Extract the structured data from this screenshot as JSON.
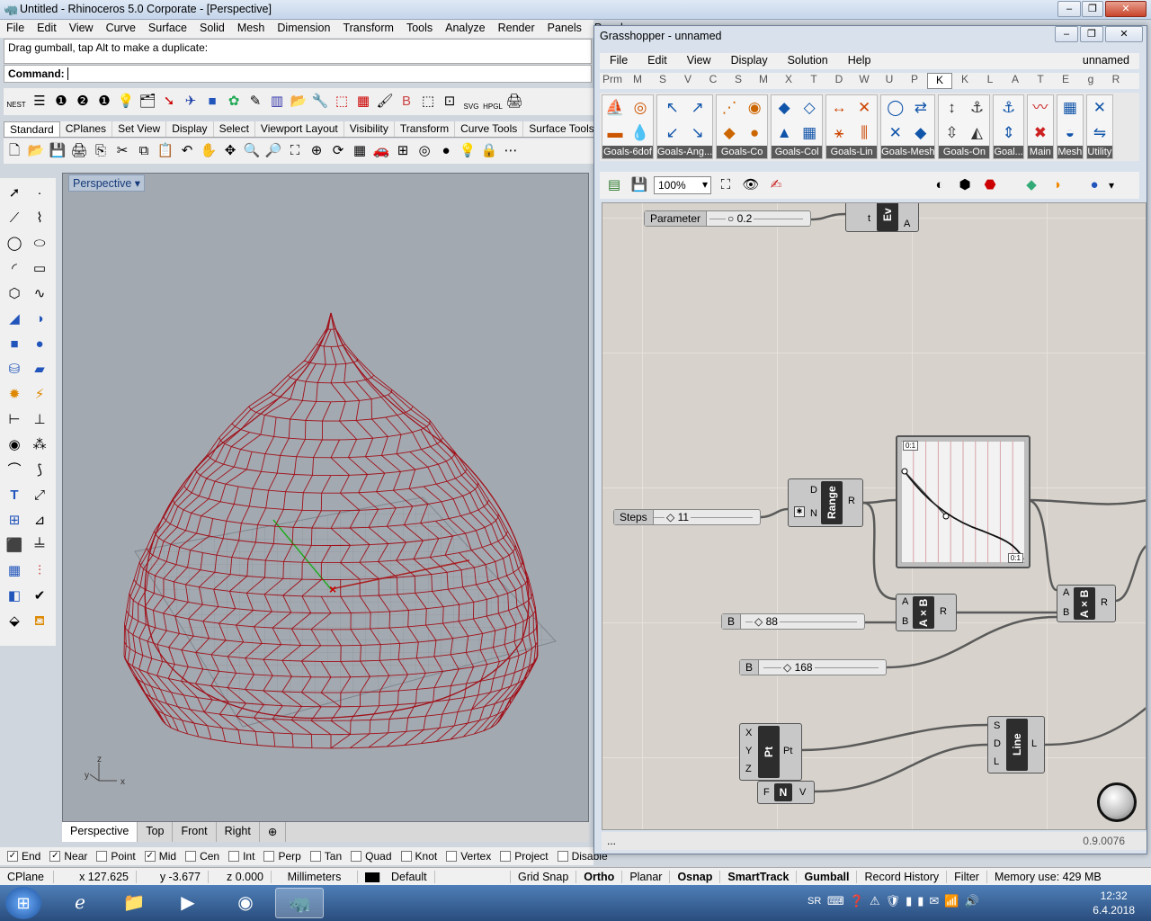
{
  "window": {
    "title": "Untitled - Rhinoceros  5.0 Corporate - [Perspective]"
  },
  "menu": [
    "File",
    "Edit",
    "View",
    "Curve",
    "Surface",
    "Solid",
    "Mesh",
    "Dimension",
    "Transform",
    "Tools",
    "Analyze",
    "Render",
    "Panels",
    "Panel"
  ],
  "command": {
    "history": "Drag gumball, tap Alt to make a duplicate:",
    "prompt": "Command:"
  },
  "tabs": [
    "Standard",
    "CPlanes",
    "Set View",
    "Display",
    "Select",
    "Viewport Layout",
    "Visibility",
    "Transform",
    "Curve Tools",
    "Surface Tools"
  ],
  "toolbar1_labels": {
    "nest": "NEST",
    "svg": "SVG",
    "hpgl": "HPGL"
  },
  "viewport": {
    "title": "Perspective",
    "axes": {
      "x": "x",
      "y": "y",
      "z": "z"
    }
  },
  "viewport_tabs": [
    "Perspective",
    "Top",
    "Front",
    "Right"
  ],
  "osnap": [
    {
      "label": "End",
      "checked": true
    },
    {
      "label": "Near",
      "checked": true
    },
    {
      "label": "Point",
      "checked": false
    },
    {
      "label": "Mid",
      "checked": true
    },
    {
      "label": "Cen",
      "checked": false
    },
    {
      "label": "Int",
      "checked": false
    },
    {
      "label": "Perp",
      "checked": false
    },
    {
      "label": "Tan",
      "checked": false
    },
    {
      "label": "Quad",
      "checked": false
    },
    {
      "label": "Knot",
      "checked": false
    },
    {
      "label": "Vertex",
      "checked": false
    },
    {
      "label": "Project",
      "checked": false
    },
    {
      "label": "Disable",
      "checked": false
    }
  ],
  "status": {
    "cplane": "CPlane",
    "x": "x 127.625",
    "y": "y -3.677",
    "z": "z 0.000",
    "units": "Millimeters",
    "layer": "Default",
    "modes": [
      "Grid Snap",
      "Ortho",
      "Planar",
      "Osnap",
      "SmartTrack",
      "Gumball",
      "Record History",
      "Filter"
    ],
    "memory": "Memory use: 429 MB"
  },
  "clock": {
    "time": "12:32",
    "date": "6.4.2018",
    "lang": "SR"
  },
  "gh": {
    "title": "Grasshopper - unnamed",
    "menu": [
      "File",
      "Edit",
      "View",
      "Display",
      "Solution",
      "Help"
    ],
    "filename": "unnamed",
    "tabs": [
      "Prm",
      "M",
      "S",
      "V",
      "C",
      "S",
      "M",
      "X",
      "T",
      "D",
      "W",
      "U",
      "P",
      "K",
      "K",
      "L",
      "A",
      "T",
      "E",
      "g",
      "R"
    ],
    "active_tab": 13,
    "groups": [
      "Goals-6dof",
      "Goals-Ang...",
      "Goals-Co",
      "Goals-Col",
      "Goals-Lin",
      "Goals-Mesh",
      "Goals-On",
      "Goal...",
      "Main",
      "Mesh",
      "Utility"
    ],
    "zoom": "100%",
    "version": "0.9.0076",
    "status_left": "...",
    "nodes": {
      "parameter": {
        "name": "Parameter",
        "value": "0.2"
      },
      "eval": {
        "core": "Ev",
        "in": "t",
        "out": "A"
      },
      "steps": {
        "name": "Steps",
        "value": "11"
      },
      "range": {
        "core": "Range",
        "in1": "D",
        "in2": "N",
        "out": "R"
      },
      "graph": {
        "tl": "0:1",
        "br": "0:1"
      },
      "mult1": {
        "core": "A×B",
        "in1": "A",
        "in2": "B",
        "out": "R"
      },
      "mult2": {
        "core": "A×B",
        "in1": "A",
        "in2": "B",
        "out": "R"
      },
      "b88": {
        "name": "B",
        "value": "88"
      },
      "b168": {
        "name": "B",
        "value": "168"
      },
      "pt": {
        "core": "Pt",
        "in1": "X",
        "in2": "Y",
        "in3": "Z",
        "out": "Pt"
      },
      "line": {
        "core": "Line",
        "in1": "S",
        "in2": "D",
        "in3": "L",
        "out": "L"
      },
      "vec": {
        "core": "N",
        "in": "F",
        "out": "V"
      }
    }
  }
}
